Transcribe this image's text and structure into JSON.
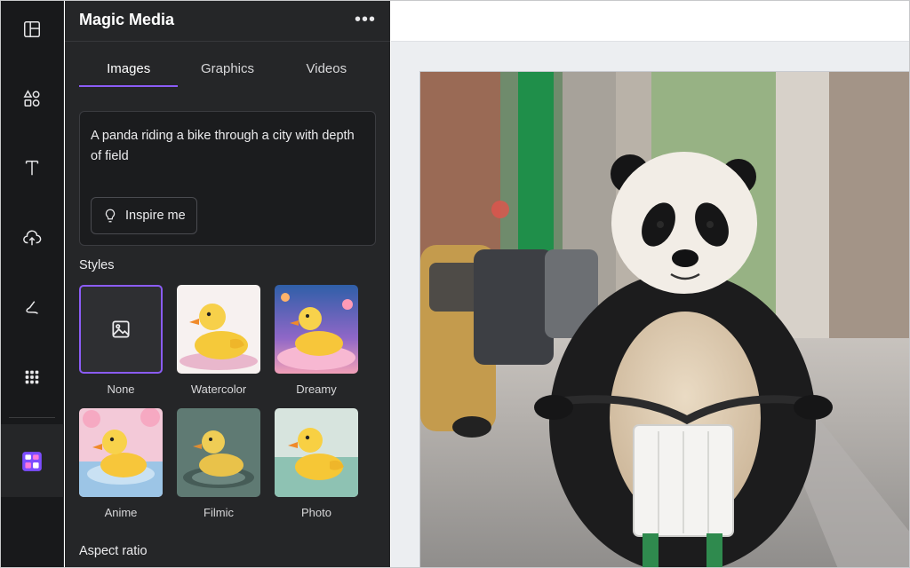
{
  "rail": {
    "items": [
      {
        "icon": "layout-icon"
      },
      {
        "icon": "elements-icon"
      },
      {
        "icon": "text-icon"
      },
      {
        "icon": "upload-icon"
      },
      {
        "icon": "draw-icon"
      },
      {
        "icon": "apps-icon"
      },
      {
        "icon": "magic-media-icon"
      }
    ],
    "active_index": 6
  },
  "panel": {
    "title": "Magic Media",
    "more": "•••",
    "tabs": [
      {
        "label": "Images",
        "active": true
      },
      {
        "label": "Graphics",
        "active": false
      },
      {
        "label": "Videos",
        "active": false
      }
    ],
    "prompt": {
      "value": "A panda riding a bike through a city with depth of field",
      "inspire_label": "Inspire me"
    },
    "styles_label": "Styles",
    "styles": [
      {
        "name": "None",
        "selected": true
      },
      {
        "name": "Watercolor",
        "selected": false
      },
      {
        "name": "Dreamy",
        "selected": false
      },
      {
        "name": "Anime",
        "selected": false
      },
      {
        "name": "Filmic",
        "selected": false
      },
      {
        "name": "Photo",
        "selected": false
      }
    ],
    "aspect_ratio_label": "Aspect ratio"
  },
  "colors": {
    "accent": "#8b5cf6",
    "rail_bg": "#18191b",
    "panel_bg": "#252628"
  },
  "canvas": {
    "image_icon": "panda-on-bike-image"
  }
}
